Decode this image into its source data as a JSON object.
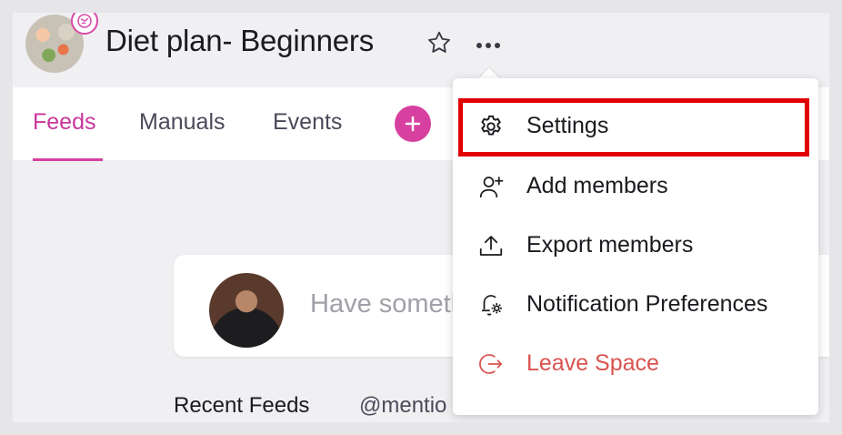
{
  "header": {
    "title": "Diet plan- Beginners",
    "star_icon": "star-outline-icon",
    "more_icon": "more-horizontal-icon"
  },
  "tabs": [
    {
      "label": "Feeds",
      "active": true
    },
    {
      "label": "Manuals",
      "active": false
    },
    {
      "label": "Events",
      "active": false
    }
  ],
  "composer": {
    "placeholder": "Have someth"
  },
  "feed_filters": {
    "recent": "Recent Feeds",
    "mentions": "@mentio"
  },
  "menu": {
    "items": [
      {
        "label": "Settings",
        "icon": "gear-icon"
      },
      {
        "label": "Add members",
        "icon": "add-user-icon"
      },
      {
        "label": "Export members",
        "icon": "upload-icon"
      },
      {
        "label": "Notification Preferences",
        "icon": "bell-settings-icon"
      },
      {
        "label": "Leave Space",
        "icon": "logout-icon"
      }
    ]
  },
  "colors": {
    "accent": "#d7409f",
    "danger": "#d9534f",
    "highlight": "#e00000"
  }
}
